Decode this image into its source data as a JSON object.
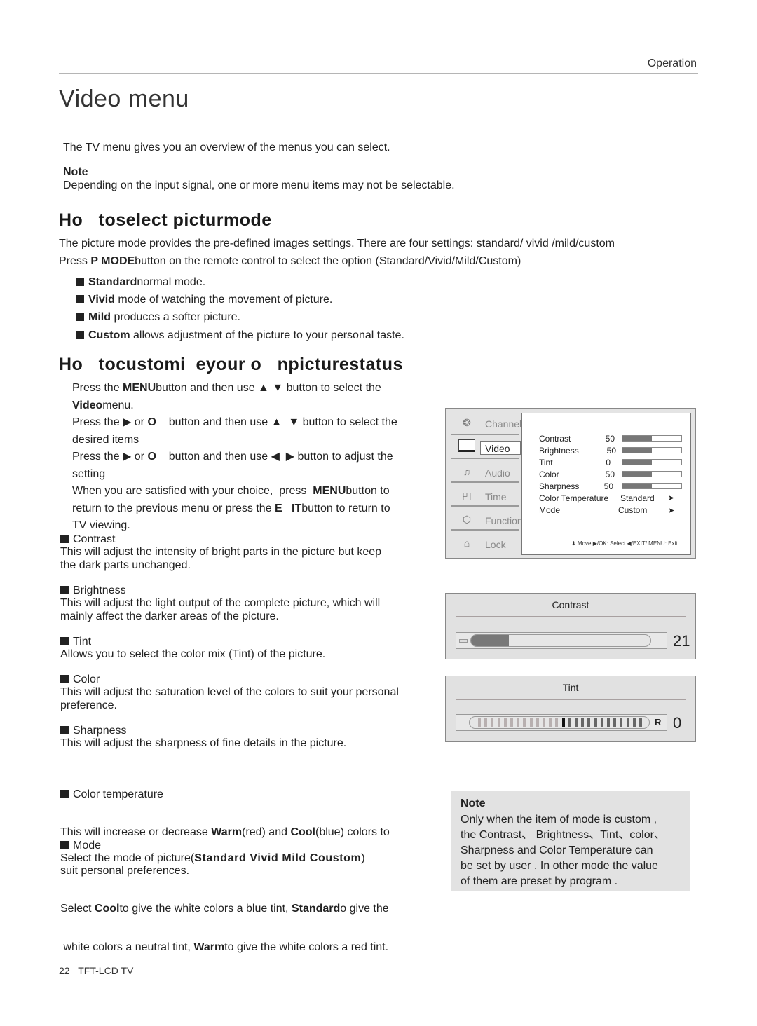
{
  "header": {
    "section": "Operation"
  },
  "title": "Video menu",
  "intro": "The TV menu gives you an overview of the menus you can select.",
  "note1": {
    "heading": "Note",
    "text": "Depending on the input signal, one or more menu items may not be selectable."
  },
  "section1": {
    "heading": "Ho   toselect picturmode",
    "para1": "The picture mode provides the pre-defined images settings. There are four settings: standard/ vivid /mild/custom",
    "para2_pre": "Press ",
    "para2_bold": "P MODE",
    "para2_post": "button on the remote control to select the option (Standard/Vivid/Mild/Custom)",
    "items": [
      {
        "bold": "Standard",
        "text": "normal mode."
      },
      {
        "bold": "Vivid",
        "text": " mode of watching the movement of picture."
      },
      {
        "bold": "Mild",
        "text": " produces a softer picture."
      },
      {
        "bold": "Custom",
        "text": " allows adjustment of the picture to your personal taste."
      }
    ]
  },
  "section2": {
    "heading": "Ho   tocustomi  eyour o   npicturestatus",
    "steps": {
      "s1a": "Press the ",
      "s1b": "MENU",
      "s1c": "button and then use ▲  ▼ button to select the",
      "s1d": "Video",
      "s1e": "menu.",
      "s2a": "Press the ▶ or ",
      "s2b": "O",
      "s2c": "    button and then use ▲  ▼ button to select the",
      "s2d": "desired items",
      "s3a": "Press the ▶ or ",
      "s3b": "O",
      "s3c": "    button and then use ◀  ▶ button to adjust the",
      "s3d": "setting",
      "s4a": "When you are satisfied with your choice,  press  ",
      "s4b": "MENU",
      "s4c": "button to",
      "s4d": "return to the previous menu or press the ",
      "s4e": "E   IT",
      "s4f": "button to return to",
      "s4g": "TV viewing."
    },
    "features": [
      {
        "name": "Contrast",
        "desc": [
          "This will adjust the intensity of bright parts in the picture but keep",
          "the dark parts unchanged."
        ]
      },
      {
        "name": "Brightness",
        "desc": [
          "This will adjust the light output of the complete picture, which will",
          "mainly affect the darker areas of the picture."
        ]
      },
      {
        "name": "Tint",
        "desc": [
          "Allows you to select the color mix (Tint) of the picture."
        ]
      },
      {
        "name": "Color",
        "desc": [
          "This will adjust the saturation level of the colors to suit your personal",
          "preference."
        ]
      },
      {
        "name": "Sharpness",
        "desc": [
          "This will adjust the sharpness of fine details in the picture."
        ]
      }
    ],
    "colortemp": {
      "name": "Color temperature",
      "l1a": "This will increase or decrease ",
      "l1b": "Warm",
      "l1c": "(red) and ",
      "l1d": "Cool",
      "l1e": "(blue) colors to",
      "l2": "suit personal preferences.",
      "l3a": "Select ",
      "l3b": "Cool",
      "l3c": "to give the white colors a blue tint, ",
      "l3d": "Standard",
      "l3e": "o give the",
      "l4a": " white colors a neutral tint, ",
      "l4b": "Warm",
      "l4c": "to give the white colors a red tint."
    },
    "mode": {
      "name": "Mode",
      "pre": "Select the mode of picture(",
      "bold": "Standard Vivid Mild Coustom",
      "post": ")"
    }
  },
  "tv_menu": {
    "sidebar": [
      {
        "label": "Channel",
        "icon": "satellite-dish-icon",
        "glyph": "❂"
      },
      {
        "label": "Video",
        "icon": "monitor-icon",
        "glyph": ""
      },
      {
        "label": "Audio",
        "icon": "audio-icon",
        "glyph": "♫"
      },
      {
        "label": "Time",
        "icon": "clock-icon",
        "glyph": "◰"
      },
      {
        "label": "Function",
        "icon": "function-icon",
        "glyph": "⬡"
      },
      {
        "label": "Lock",
        "icon": "lock-icon",
        "glyph": "⌂"
      }
    ],
    "selected": "Video",
    "rows": [
      {
        "label": "Contrast",
        "value": "50",
        "level": 0.5
      },
      {
        "label": "Brightness",
        "value": "50",
        "level": 0.5
      },
      {
        "label": "Tint",
        "value": "0",
        "level": 0.5
      },
      {
        "label": "Color",
        "value": "50",
        "level": 0.5
      },
      {
        "label": "Sharpness",
        "value": "50",
        "level": 0.5
      }
    ],
    "options": [
      {
        "label": "Color Temperature",
        "value": "Standard"
      },
      {
        "label": "Mode",
        "value": "Custom"
      }
    ],
    "help": "⬍ Move  ▶/OK: Select  ◀/EXIT/ MENU: Exit"
  },
  "contrast_osd": {
    "title": "Contrast",
    "value": "21",
    "level": 0.21
  },
  "tint_osd": {
    "title": "Tint",
    "value": "0",
    "marker": "R",
    "level": 0.5
  },
  "note2": {
    "heading": "Note",
    "lines": [
      "Only when the item of mode is custom ,",
      "the Contrast、 Brightness、Tint、color、",
      "Sharpness and Color Temperature can",
      "be set by user . In other mode the value",
      "of them are preset by program ."
    ]
  },
  "footer": {
    "page": "22",
    "product": "TFT-LCD TV"
  }
}
